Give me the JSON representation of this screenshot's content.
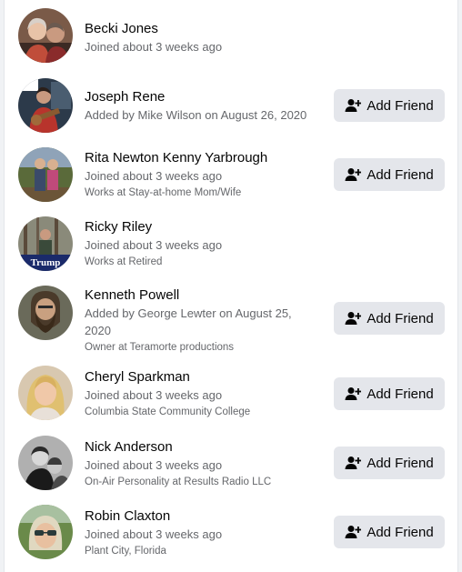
{
  "colors": {
    "background": "#f0f2f5",
    "card": "#ffffff",
    "primary_text": "#050505",
    "secondary_text": "#65676b",
    "button_bg": "#e4e6eb"
  },
  "people": [
    {
      "name": "Becki Jones",
      "line1": "Joined about 3 weeks ago",
      "line2": "",
      "action": null,
      "avatar_icon": "profile-photo"
    },
    {
      "name": "Joseph Rene",
      "line1": "Added by Mike Wilson on August 26, 2020",
      "line2": "",
      "action": "Add Friend",
      "avatar_icon": "profile-photo"
    },
    {
      "name": "Rita Newton Kenny Yarbrough",
      "line1": "Joined about 3 weeks ago",
      "line2": "Works at Stay-at-home Mom/Wife",
      "action": "Add Friend",
      "avatar_icon": "profile-photo"
    },
    {
      "name": "Ricky Riley",
      "line1": "Joined about 3 weeks ago",
      "line2": "Works at Retired",
      "action": null,
      "avatar_icon": "profile-photo",
      "avatar_text": "Trump"
    },
    {
      "name": "Kenneth Powell",
      "line1": "Added by George Lewter on August 25, 2020",
      "line2": "Owner at Teramorte productions",
      "action": "Add Friend",
      "avatar_icon": "profile-photo"
    },
    {
      "name": "Cheryl Sparkman",
      "line1": "Joined about 3 weeks ago",
      "line2": "Columbia State Community College",
      "action": "Add Friend",
      "avatar_icon": "profile-photo"
    },
    {
      "name": "Nick Anderson",
      "line1": "Joined about 3 weeks ago",
      "line2": "On-Air Personality at Results Radio LLC",
      "action": "Add Friend",
      "avatar_icon": "profile-photo"
    },
    {
      "name": "Robin Claxton",
      "line1": "Joined about 3 weeks ago",
      "line2": "Plant City, Florida",
      "action": "Add Friend",
      "avatar_icon": "profile-photo"
    }
  ],
  "button_icon": "add-friend-icon"
}
